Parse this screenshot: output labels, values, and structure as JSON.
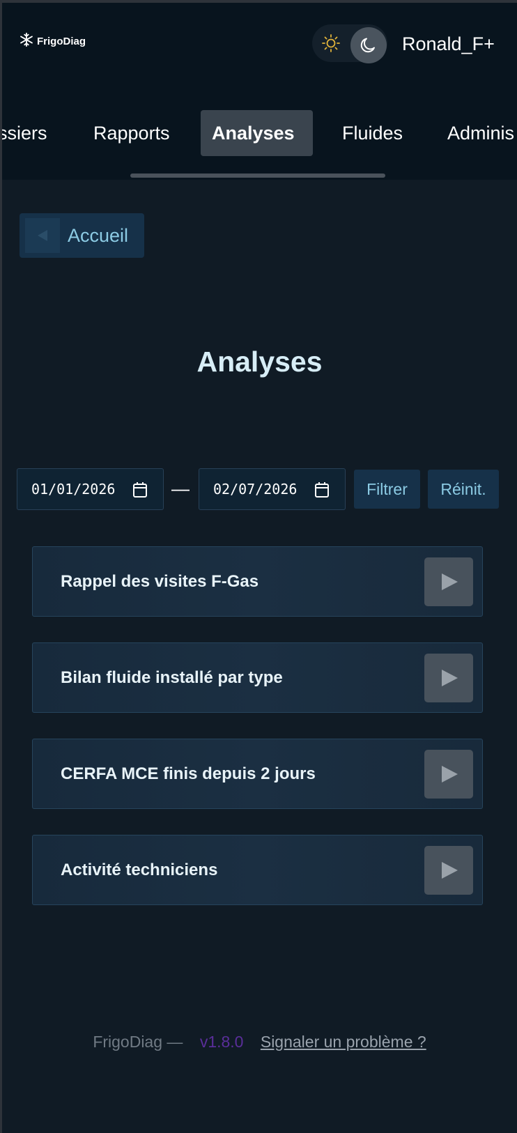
{
  "header": {
    "brand": "FrigoDiag",
    "user": "Ronald_F+",
    "theme": {
      "sun_icon": "sun-icon",
      "moon_icon": "moon-icon",
      "active": "dark"
    }
  },
  "nav": {
    "items": [
      {
        "label": "ssiers"
      },
      {
        "label": "Rapports"
      },
      {
        "label": "Analyses",
        "active": true
      },
      {
        "label": "Fluides"
      },
      {
        "label": "Adminis"
      }
    ]
  },
  "back": {
    "label": "Accueil",
    "icon": "back-arrow-icon"
  },
  "title": "Analyses",
  "filter": {
    "from": "01/01/2026",
    "separator": "—",
    "to": "02/07/2026",
    "filter_label": "Filtrer",
    "reset_label": "Réinit."
  },
  "reports": [
    {
      "label": "Rappel des visites F-Gas"
    },
    {
      "label": "Bilan fluide installé par type"
    },
    {
      "label": "CERFA MCE finis depuis 2 jours"
    },
    {
      "label": "Activité techniciens"
    }
  ],
  "footer": {
    "brand": "FrigoDiag —",
    "version": "v1.8.0",
    "report_link": "Signaler un problème ?"
  },
  "colors": {
    "background": "#101b25",
    "header": "#08141e",
    "accent_text": "#8ccbe4",
    "button_bg": "#163149",
    "version": "#5a2e9a"
  }
}
